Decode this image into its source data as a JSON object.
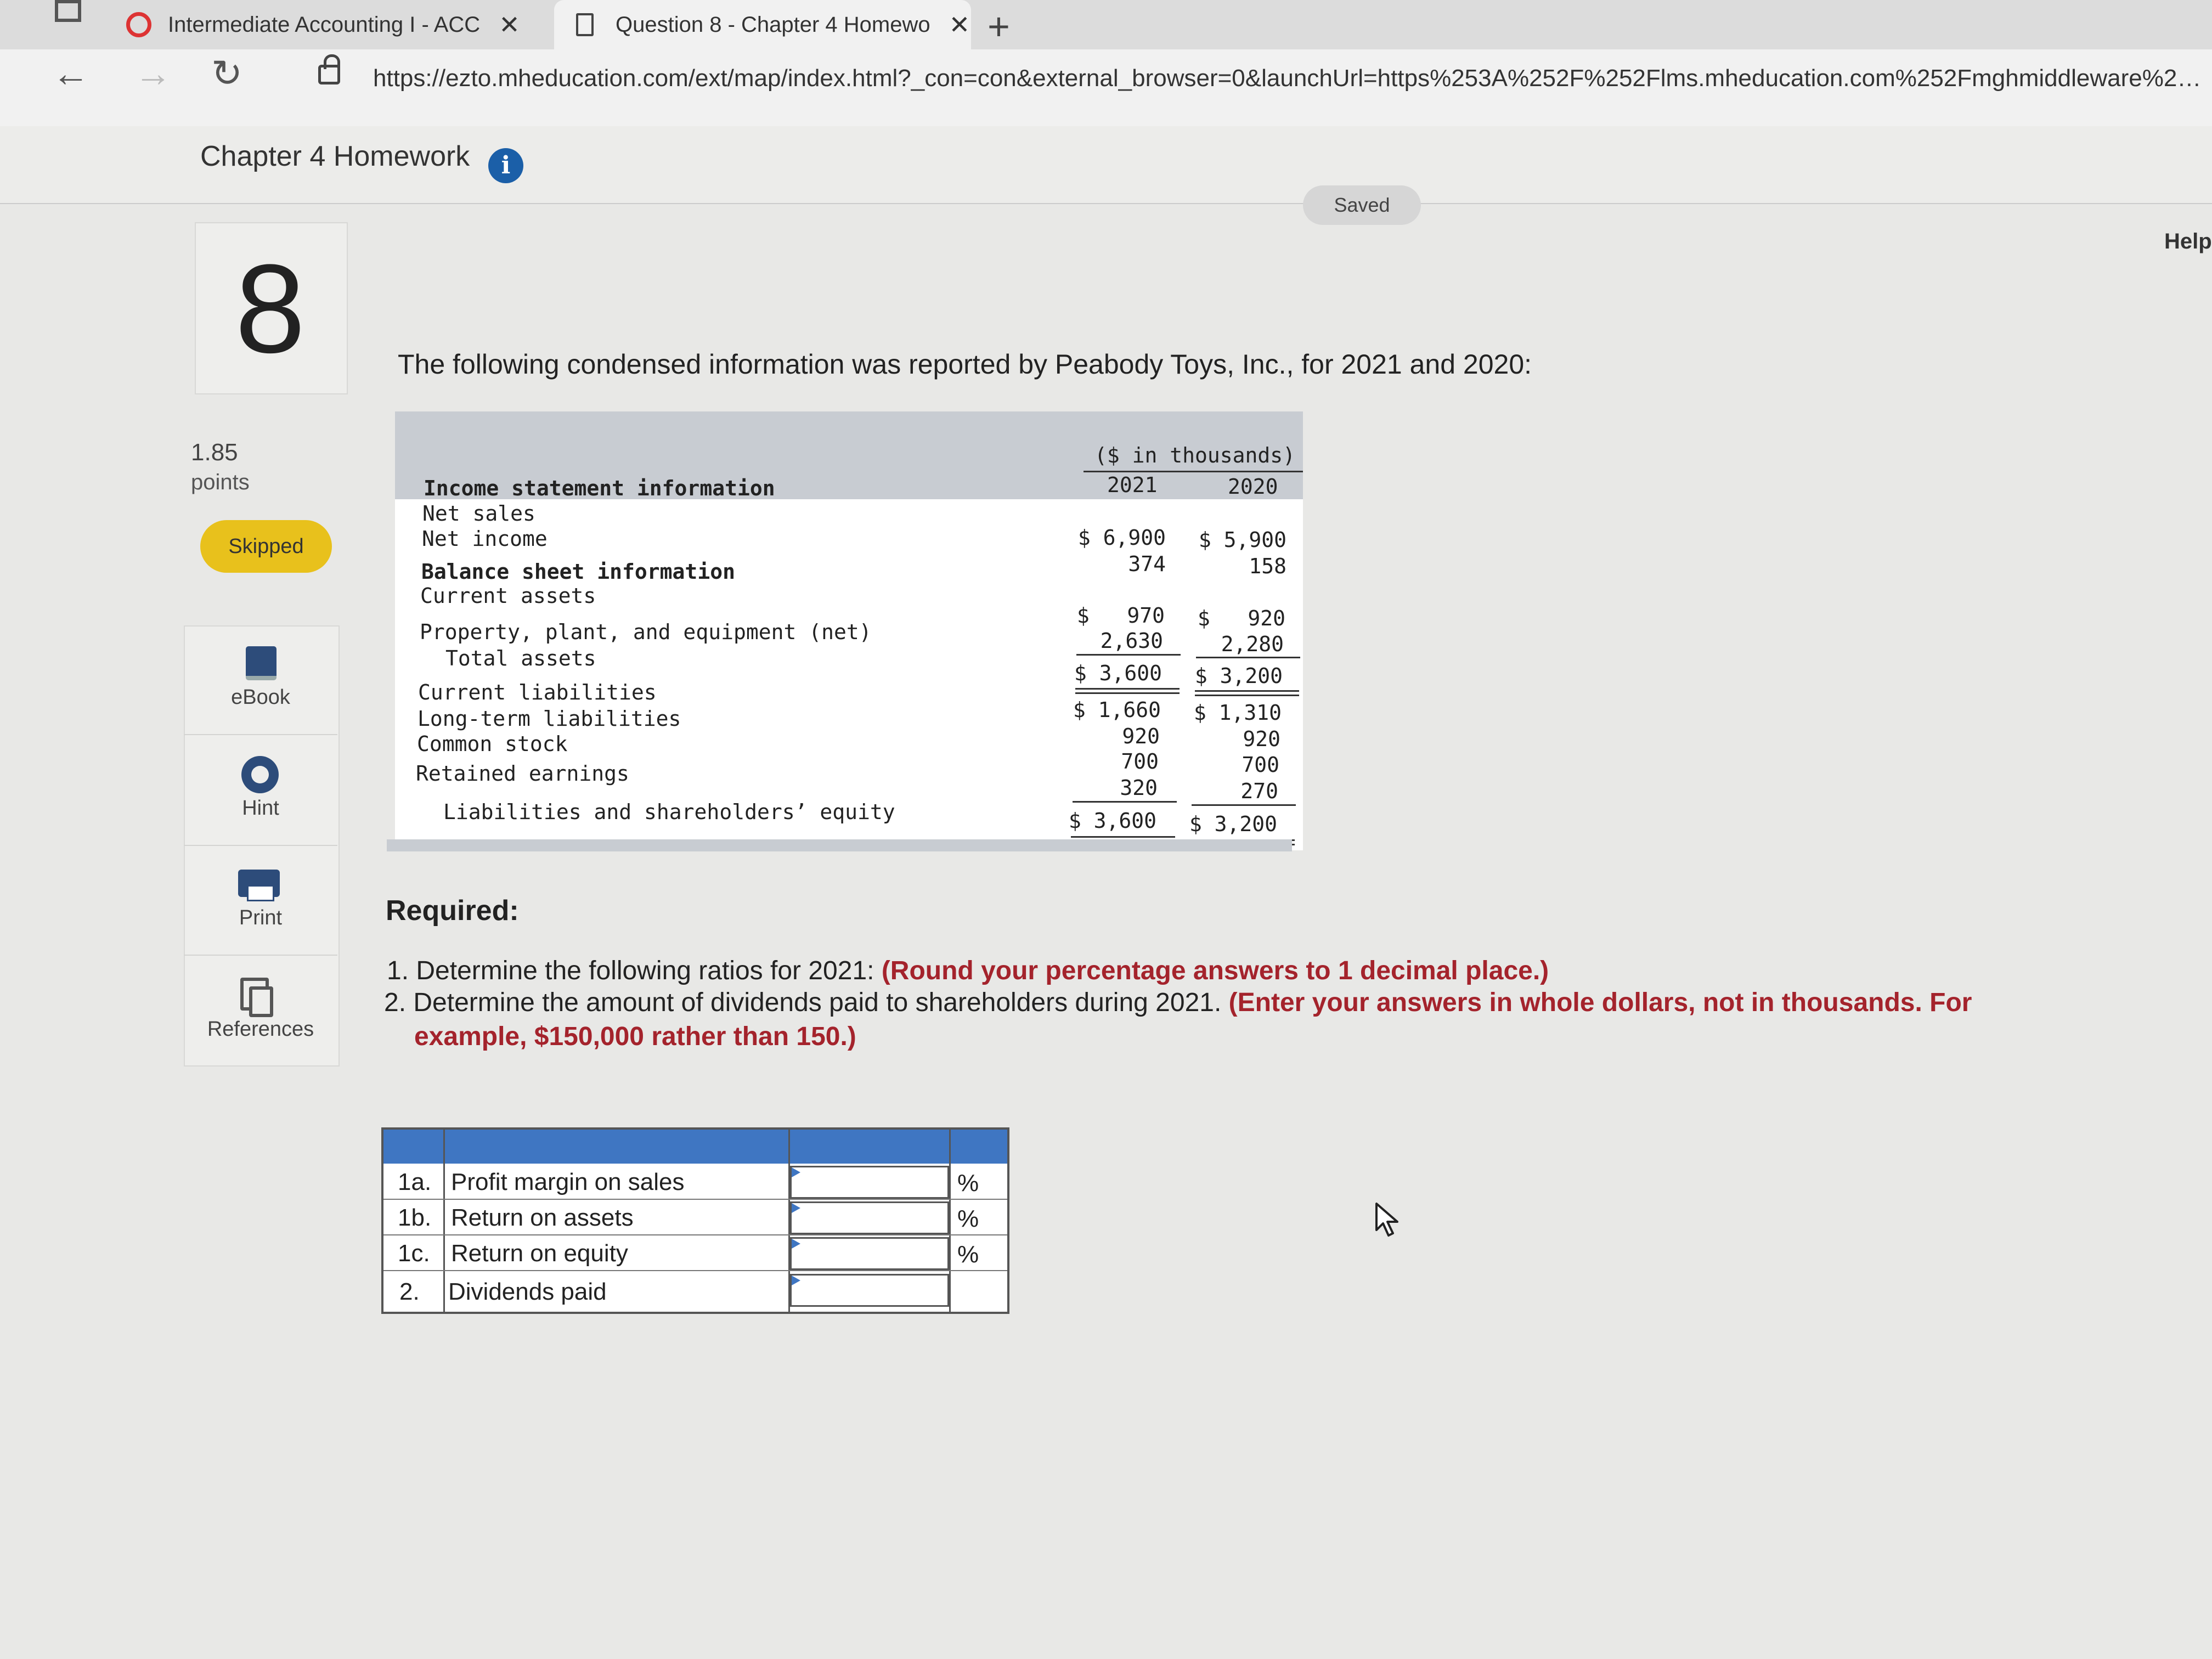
{
  "browser": {
    "tabs": [
      {
        "label": "Intermediate Accounting I - ACC",
        "close": "✕"
      },
      {
        "label": "Question 8 - Chapter 4 Homewo",
        "close": "✕"
      }
    ],
    "new_tab": "+",
    "url": "https://ezto.mheducation.com/ext/map/index.html?_con=con&external_browser=0&launchUrl=https%253A%252F%252Flms.mheducation.com%252Fmghmiddleware%252..."
  },
  "header": {
    "title": "Chapter 4 Homework",
    "info": "i",
    "saved": "Saved",
    "help": "Help"
  },
  "question": {
    "number": "8",
    "points_value": "1.85",
    "points_label": "points",
    "status": "Skipped"
  },
  "tools": [
    {
      "label": "eBook",
      "icon": "book-icon"
    },
    {
      "label": "Hint",
      "icon": "lifebuoy-icon"
    },
    {
      "label": "Print",
      "icon": "printer-icon"
    },
    {
      "label": "References",
      "icon": "documents-icon"
    }
  ],
  "intro": "The following condensed information was reported by Peabody Toys, Inc., for 2021 and 2020:",
  "financials": {
    "units_header": "($ in thousands)",
    "years": [
      "2021",
      "2020"
    ],
    "rows": [
      {
        "label": "Income statement information",
        "v2021": "",
        "v2020": ""
      },
      {
        "label": "Net sales",
        "v2021": "$ 6,900",
        "v2020": "$ 5,900"
      },
      {
        "label": "Net income",
        "v2021": "374",
        "v2020": "158"
      },
      {
        "label": "Balance sheet information",
        "v2021": "",
        "v2020": ""
      },
      {
        "label": "Current assets",
        "v2021": "$   970",
        "v2020": "$   920"
      },
      {
        "label": "Property, plant, and equipment (net)",
        "v2021": "2,630",
        "v2020": "2,280"
      },
      {
        "label": "Total assets",
        "v2021": "$ 3,600",
        "v2020": "$ 3,200"
      },
      {
        "label": "Current liabilities",
        "v2021": "$ 1,660",
        "v2020": "$ 1,310"
      },
      {
        "label": "Long-term liabilities",
        "v2021": "920",
        "v2020": "920"
      },
      {
        "label": "Common stock",
        "v2021": "700",
        "v2020": "700"
      },
      {
        "label": "Retained earnings",
        "v2021": "320",
        "v2020": "270"
      },
      {
        "label": "Liabilities and shareholders’ equity",
        "v2021": "$ 3,600",
        "v2020": "$ 3,200"
      }
    ]
  },
  "required": {
    "title": "Required:",
    "item1_text": "1. Determine the following ratios for 2021:",
    "item1_note": "(Round your percentage answers to 1 decimal place.)",
    "item2_text": "2. Determine the amount of dividends paid to shareholders during 2021.",
    "item2_note_a": "(Enter your answers in whole dollars, not in thousands. For",
    "item2_note_b": "example, $150,000 rather than 150.)"
  },
  "answers": [
    {
      "id": "1a.",
      "label": "Profit margin on sales",
      "value": "",
      "unit": "%"
    },
    {
      "id": "1b.",
      "label": "Return on assets",
      "value": "",
      "unit": "%"
    },
    {
      "id": "1c.",
      "label": "Return on equity",
      "value": "",
      "unit": "%"
    },
    {
      "id": "2.",
      "label": "Dividends paid",
      "value": "",
      "unit": ""
    }
  ]
}
